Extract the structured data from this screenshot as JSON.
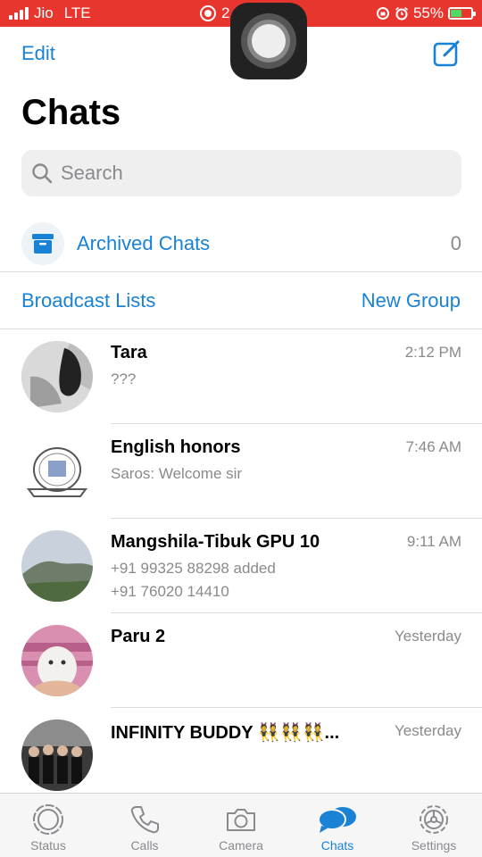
{
  "status_bar": {
    "carrier": "Jio",
    "network": "LTE",
    "center_fragment": "2",
    "battery": "55%",
    "battery_level": 0.55,
    "bar_color": "#e8352e"
  },
  "header": {
    "edit_label": "Edit",
    "compose_icon": "compose-icon",
    "title": "Chats"
  },
  "search": {
    "placeholder": "Search"
  },
  "archived": {
    "label": "Archived Chats",
    "count": "0"
  },
  "actions": {
    "broadcast_label": "Broadcast Lists",
    "new_group_label": "New Group"
  },
  "chats": [
    {
      "name": "Tara",
      "time": "2:12 PM",
      "message_line1": "???",
      "message_line2": ""
    },
    {
      "name": "English honors",
      "time": "7:46 AM",
      "message_line1": "Saros: Welcome sir",
      "message_line2": ""
    },
    {
      "name": "Mangshila-Tibuk GPU 10",
      "time": "9:11 AM",
      "message_line1": "+91 99325 88298 added",
      "message_line2": "+91 76020 14410"
    },
    {
      "name": "Paru 2",
      "time": "Yesterday",
      "message_line1": "",
      "message_line2": ""
    },
    {
      "name": "INFINITY BUDDY 👯👯👯...",
      "time": "Yesterday",
      "message_line1": "",
      "message_line2": ""
    }
  ],
  "tabs": [
    {
      "label": "Status",
      "icon": "status-icon"
    },
    {
      "label": "Calls",
      "icon": "phone-icon"
    },
    {
      "label": "Camera",
      "icon": "camera-icon"
    },
    {
      "label": "Chats",
      "icon": "chat-bubbles-icon",
      "active": true
    },
    {
      "label": "Settings",
      "icon": "gear-icon"
    }
  ],
  "colors": {
    "accent": "#1a82d4",
    "secondary_text": "#8a8a8e"
  }
}
